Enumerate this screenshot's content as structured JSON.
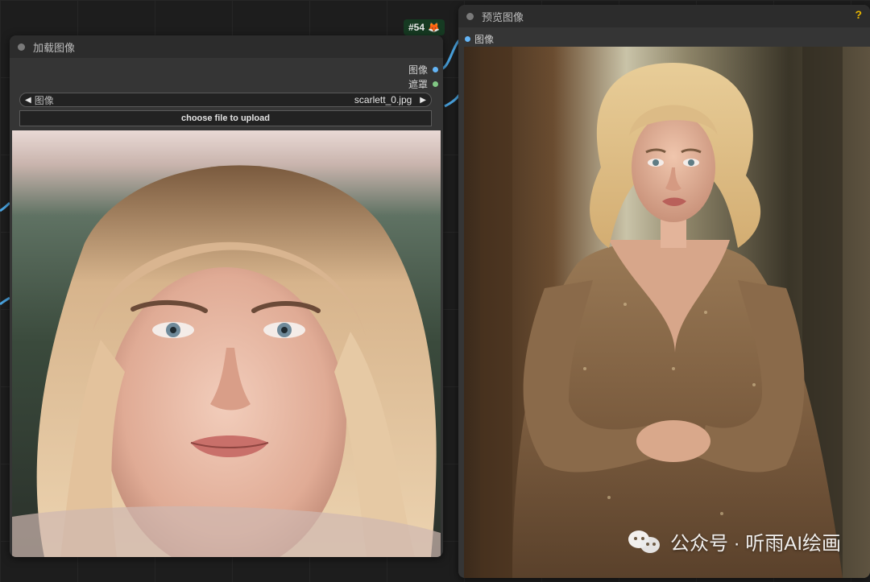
{
  "load_node": {
    "title": "加载图像",
    "outputs": [
      {
        "label": "图像",
        "color": "#64b5f6"
      },
      {
        "label": "遮罩",
        "color": "#81c784"
      }
    ],
    "image_widget": {
      "label": "图像",
      "value": "scarlett_0.jpg",
      "left_arrow": "◀",
      "right_arrow": "▶"
    },
    "upload_button": "choose file to upload",
    "badge": {
      "text": "#54",
      "icon": "fox-icon"
    }
  },
  "preview_node": {
    "title": "预览图像",
    "input_label": "图像",
    "input_color": "#64b5f6",
    "help": "?"
  },
  "watermark": {
    "text": "公众号 · 听雨AI绘画",
    "icon": "wechat-icon"
  },
  "colors": {
    "link": "#4aa3df",
    "canvas": "#1d1d1d",
    "node_body": "#353535",
    "node_title": "#2c2c2c",
    "badge_bg": "#163a22"
  }
}
